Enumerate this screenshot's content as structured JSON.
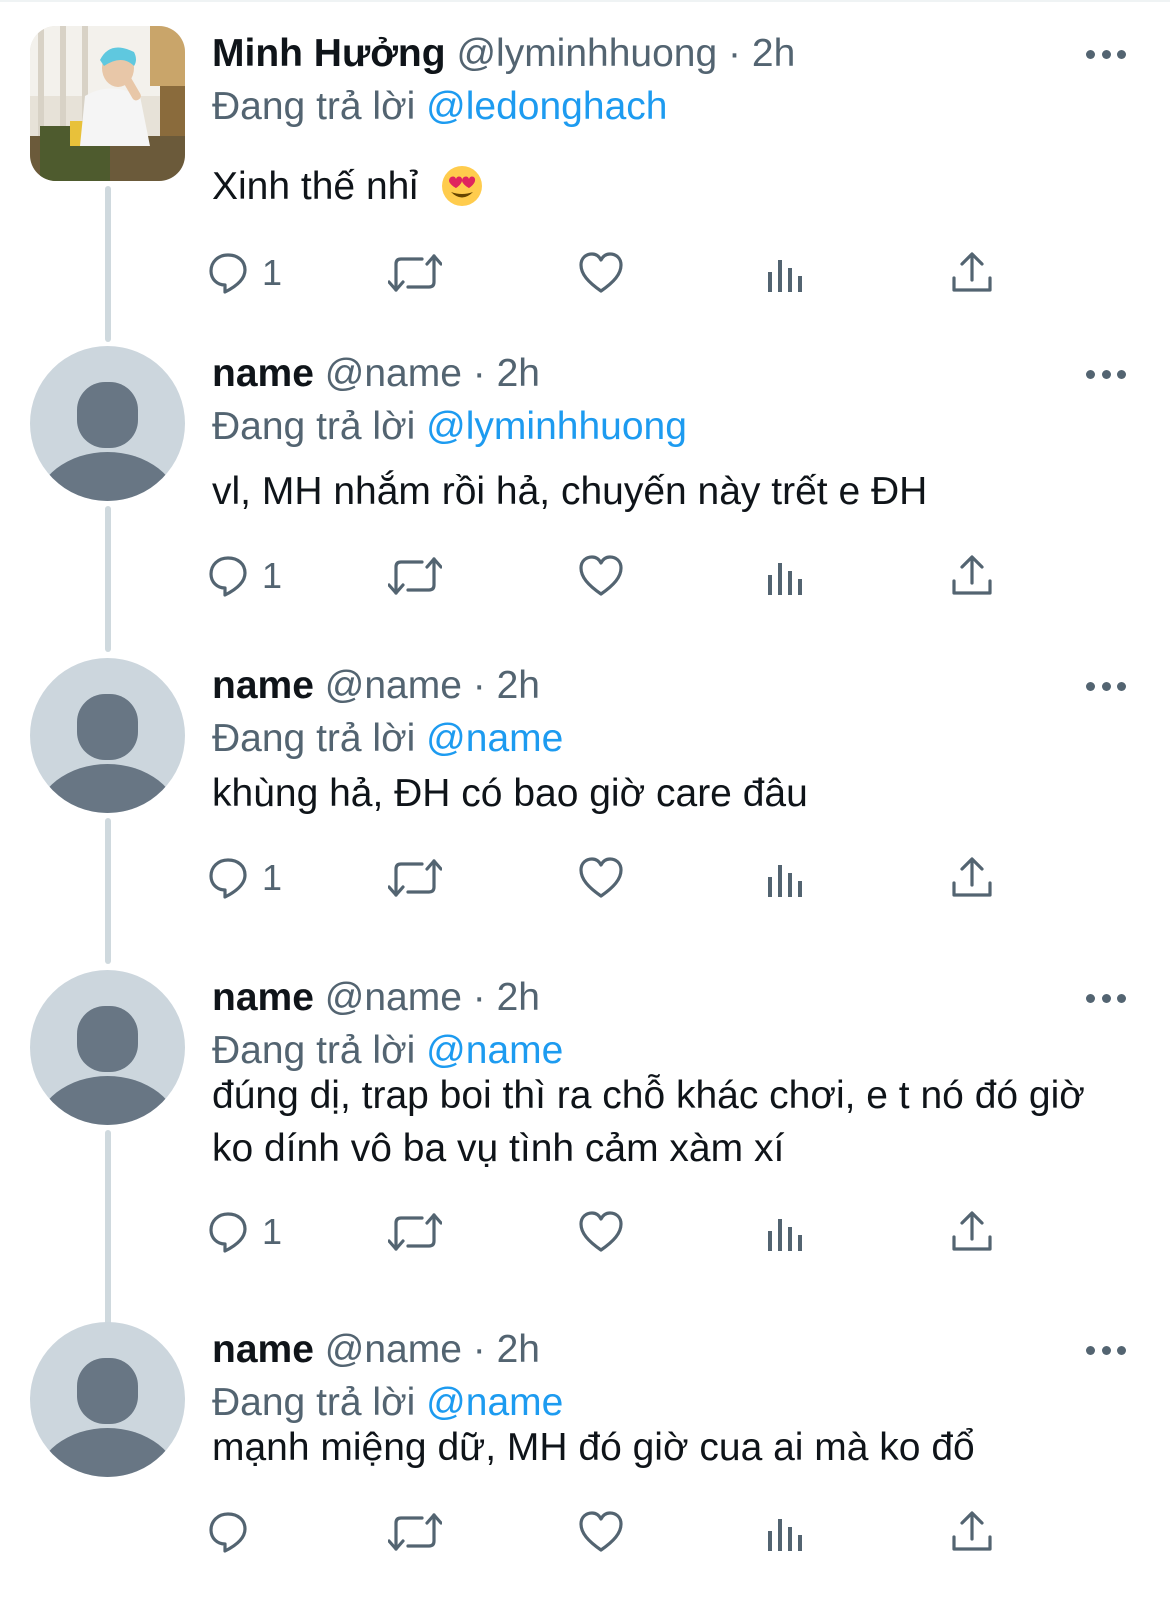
{
  "colors": {
    "text_primary": "#0f1419",
    "text_secondary": "#536471",
    "link": "#1d9bf0",
    "thread_line": "#cfd9de",
    "default_avatar_bg": "#ccd6dd",
    "default_avatar_fg": "#687684"
  },
  "icons": [
    "reply-icon",
    "retweet-icon",
    "like-icon",
    "views-icon",
    "share-icon",
    "more-icon",
    "heart-eyes-emoji"
  ],
  "labels": {
    "replying_to": "Đang trả lời"
  },
  "tweets": [
    {
      "display_name": "Minh Hưởng",
      "handle": "@lyminhhuong",
      "dot": "·",
      "time": "2h",
      "replying_to_handle": "@ledonghach",
      "text": "Xinh thế nhỉ",
      "emoji": "heart-eyes-emoji",
      "reply_count": "1",
      "avatar": "photo"
    },
    {
      "display_name": "name",
      "handle": "@name",
      "dot": "·",
      "time": "2h",
      "replying_to_handle": "@lyminhhuong",
      "text": "vl, MH nhắm rồi hả, chuyến này trết e ĐH",
      "reply_count": "1",
      "avatar": "default"
    },
    {
      "display_name": "name",
      "handle": "@name",
      "dot": "·",
      "time": "2h",
      "replying_to_handle": "@name",
      "text": "khùng hả, ĐH có bao giờ care đâu",
      "reply_count": "1",
      "avatar": "default"
    },
    {
      "display_name": "name",
      "handle": "@name",
      "dot": "·",
      "time": "2h",
      "replying_to_handle": "@name",
      "text": "đúng dị, trap boi thì ra chỗ khác chơi, e t nó đó giờ ko dính vô ba vụ tình cảm xàm xí",
      "reply_count": "1",
      "avatar": "default"
    },
    {
      "display_name": "name",
      "handle": "@name",
      "dot": "·",
      "time": "2h",
      "replying_to_handle": "@name",
      "text": "mạnh miệng dữ, MH đó giờ cua ai mà ko đổ",
      "reply_count": "",
      "avatar": "default"
    }
  ]
}
